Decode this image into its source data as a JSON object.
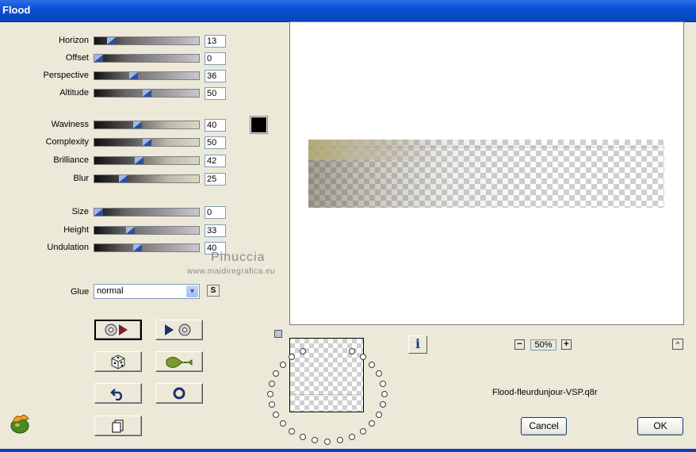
{
  "window": {
    "title": "Flood"
  },
  "params": [
    {
      "label": "Horizon",
      "value": "13",
      "level": 0.13,
      "gradient": "gray"
    },
    {
      "label": "Offset",
      "value": "0",
      "level": 0.0,
      "gradient": "gray"
    },
    {
      "label": "Perspective",
      "value": "36",
      "level": 0.36,
      "gradient": "gray"
    },
    {
      "label": "Altitude",
      "value": "50",
      "level": 0.5,
      "gradient": "gray"
    },
    {
      "label": "Waviness",
      "value": "40",
      "level": 0.4,
      "gradient": "olive"
    },
    {
      "label": "Complexity",
      "value": "50",
      "level": 0.5,
      "gradient": "olive"
    },
    {
      "label": "Brilliance",
      "value": "42",
      "level": 0.42,
      "gradient": "olive"
    },
    {
      "label": "Blur",
      "value": "25",
      "level": 0.25,
      "gradient": "olive"
    },
    {
      "label": "Size",
      "value": "0",
      "level": 0.0,
      "gradient": "gray"
    },
    {
      "label": "Height",
      "value": "33",
      "level": 0.33,
      "gradient": "gray"
    },
    {
      "label": "Undulation",
      "value": "40",
      "level": 0.4,
      "gradient": "gray"
    }
  ],
  "color_swatch": "#000000",
  "watermark": {
    "name": "Pinuccia",
    "site": "www.maidiregrafica.eu"
  },
  "glue": {
    "label": "Glue",
    "value": "normal",
    "s_button": "S"
  },
  "tool_buttons": [
    {
      "icon": "render-forward-icon"
    },
    {
      "icon": "render-backward-icon"
    },
    {
      "icon": "dice-icon"
    },
    {
      "icon": "wave-icon"
    },
    {
      "icon": "undo-icon"
    },
    {
      "icon": "reset-circle-icon"
    },
    {
      "icon": "copy-page-icon"
    }
  ],
  "zoom": {
    "value": "50%",
    "minus": "−",
    "plus": "+"
  },
  "info_label": "i",
  "caret_label": "^",
  "filename": "Flood-fleurdunjour-VSP.q8r",
  "buttons": {
    "cancel": "Cancel",
    "ok": "OK"
  }
}
